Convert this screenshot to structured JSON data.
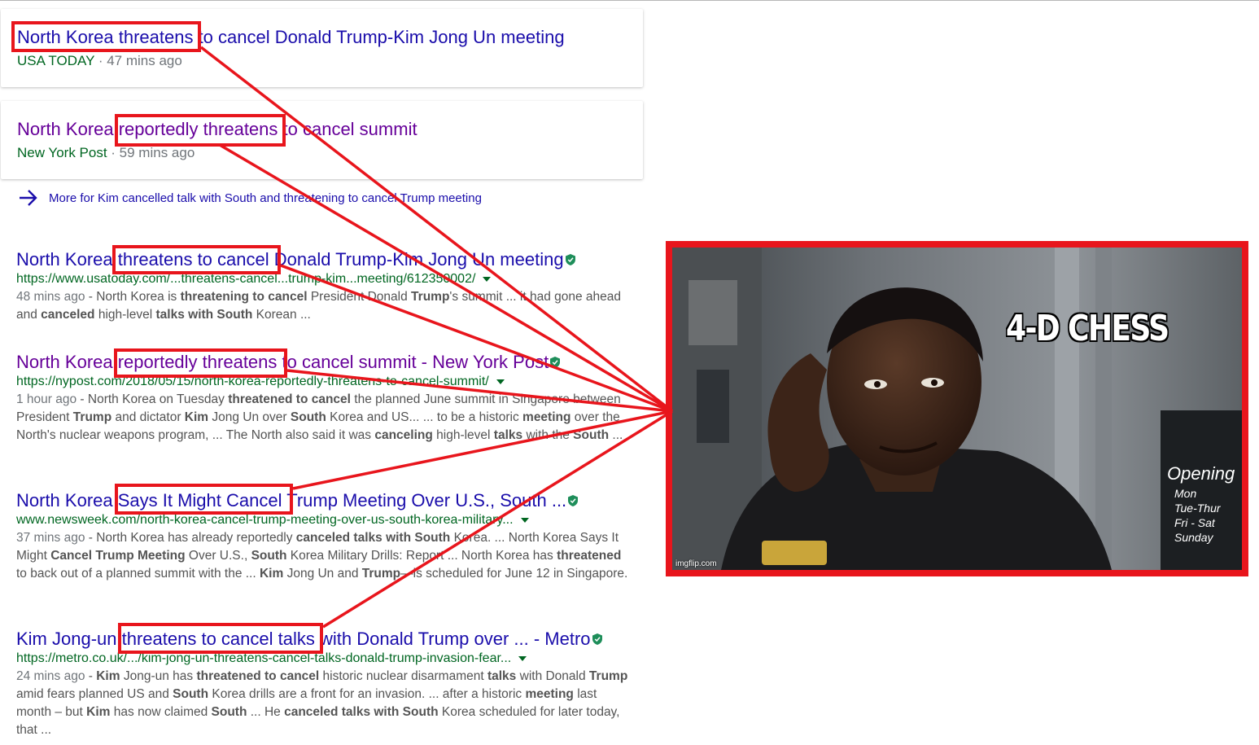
{
  "news_cards": [
    {
      "title": "North Korea threatens to cancel Donald Trump-Kim Jong Un meeting",
      "source": "USA TODAY",
      "time": " · 47 mins ago",
      "visited": false
    },
    {
      "title": "North Korea reportedly threatens to cancel summit",
      "source": "New York Post",
      "time": " · 59 mins ago",
      "visited": true
    }
  ],
  "more_link": "More for Kim cancelled talk with South and threatening to cancel Trump meeting",
  "results": [
    {
      "title": "North Korea threatens to cancel Donald Trump-Kim Jong Un meeting",
      "url": "https://www.usatoday.com/...threatens-cancel...trump-kim...meeting/612350002/",
      "date": "48 mins ago",
      "snippet_html": " - North Korea is <b>threatening to cancel</b> President Donald <b>Trump</b>'s summit ... it had gone ahead and <b>canceled</b> high-level <b>talks with South</b> Korean ...",
      "visited": false
    },
    {
      "title": "North Korea reportedly threatens to cancel summit - New York Post",
      "url": "https://nypost.com/2018/05/15/north-korea-reportedly-threatens-to-cancel-summit/",
      "date": "1 hour ago",
      "snippet_html": " - North Korea on Tuesday <b>threatened to cancel</b> the planned June summit in Singapore between President <b>Trump</b> and dictator <b>Kim</b> Jong Un over <b>South</b> Korea and US... ... to be a historic <b>meeting</b> over the North's nuclear weapons program, ... The North also said it was <b>canceling</b> high-level <b>talks</b> with the <b>South</b> ...",
      "visited": true
    },
    {
      "title": "North Korea Says It Might Cancel Trump Meeting Over U.S., South ...",
      "url": "www.newsweek.com/north-korea-cancel-trump-meeting-over-us-south-korea-military...",
      "date": "37 mins ago",
      "snippet_html": " - North Korea has already reportedly <b>canceled talks with South</b> Korea. ... North Korea Says It Might <b>Cancel Trump Meeting</b> Over U.S., <b>South</b> Korea Military Drills: Report ... North Korea has <b>threatened</b> to back out of a planned summit with the ... <b>Kim</b> Jong Un and <b>Trump</b>—is scheduled for June 12 in Singapore.",
      "visited": false
    },
    {
      "title": "Kim Jong-un threatens to cancel talks with Donald Trump over ... - Metro",
      "url": "https://metro.co.uk/.../kim-jong-un-threatens-cancel-talks-donald-trump-invasion-fear...",
      "date": "24 mins ago",
      "snippet_html": " - <b>Kim</b> Jong-un has <b>threatened to cancel</b> historic nuclear disarmament <b>talks</b> with Donald <b>Trump</b> amid fears planned US and <b>South</b> Korea drills are a front for an invasion. ... after a historic <b>meeting</b> last month – but <b>Kim</b> has now claimed <b>South</b> ... He <b>canceled talks with South</b> Korea scheduled for later today, that ...",
      "visited": false
    }
  ],
  "highlighted_phrases": [
    "threatens",
    "reportedly threatens",
    "threatens to cancel",
    "reportedly threatens",
    "Says It Might Cancel",
    "threatens to cancel talks"
  ],
  "meme": {
    "caption": "4-D CHESS",
    "watermark": "imgflip.com",
    "sign_text": [
      "Opening",
      "Mon",
      "Tue-Thur",
      "Fri - Sat",
      "Sunday"
    ]
  },
  "colors": {
    "highlight": "#e8151c",
    "link": "#1a0dab",
    "visited": "#660099",
    "url": "#006621",
    "snippet": "#545454"
  }
}
